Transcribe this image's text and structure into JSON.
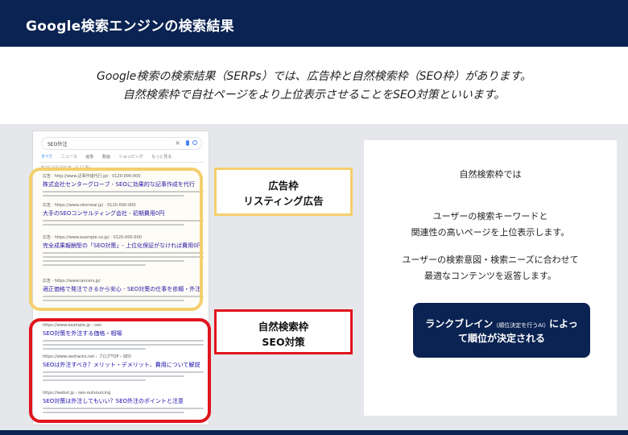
{
  "header": {
    "title": "Google検索エンジンの検索結果"
  },
  "intro": {
    "line1": "Google検索の検索結果（SERPs）では、広告枠と自然検索枠（SEO枠）があります。",
    "line2": "自然検索枠で自社ページをより上位表示させることをSEO対策といいます。"
  },
  "serp": {
    "query": "SEO外注",
    "tabs": [
      "すべて",
      "ニュース",
      "画像",
      "動画",
      "ショッピング",
      "もっと見る"
    ],
    "result_count": "約 60,400,000 件 （0.51 秒）",
    "ads": [
      {
        "url": "広告 · http://www.記事作成代行.jp/ · 0120-000-000",
        "title": "株式会社センターグローブ - SEOに効果的な記事作成を代行"
      },
      {
        "url": "広告 · https://www.sitemeal.jp/ · 0120-000-000",
        "title": "大手のSEOコンサルティング会社 - 初期費用0円"
      },
      {
        "url": "広告 · https://www.example.co.jp/ · 0120-000-000",
        "title": "完全成果報酬型の「SEO対策」- 上位化保証がなければ費用0円"
      },
      {
        "url": "広告 · https://www.lancers.jp/",
        "title": "適正価格で発注できるから安心 - SEO対策の仕事を依頼・外注"
      }
    ],
    "organic": [
      {
        "url": "https://www.example.jp › seo",
        "title": "SEO対策を外注する価格・相場"
      },
      {
        "url": "https://www.seohacks.net › ブログTOP › SEO",
        "title": "SEOは外注すべき？メリット・デメリット、費用について解説"
      },
      {
        "url": "https://webst.jp › seo-outsourcing",
        "title": "SEO対策は外注してもいい？SEO外注のポイントと注意"
      }
    ]
  },
  "labels": {
    "ad_line1": "広告枠",
    "ad_line2": "リスティング広告",
    "organic_line1": "自然検索枠",
    "organic_line2": "SEO対策"
  },
  "panel": {
    "line1": "自然検索枠では",
    "line2": "ユーザーの検索キーワードと",
    "line3": "関連性の高いページを上位表示します。",
    "line4": "ユーザーの検索意図・検索ニーズに合わせて",
    "line5": "最適なコンテンツを返答します。",
    "button_main": "ランクブレイン",
    "button_note": "（順位決定を行うAI）",
    "button_suffix": "によっ",
    "button_line2": "て順位が決定される"
  },
  "colors": {
    "navy": "#0b2352",
    "ad_frame": "#f4cf6d",
    "organic_frame": "#e0141e",
    "background": "#e5e7ea"
  }
}
